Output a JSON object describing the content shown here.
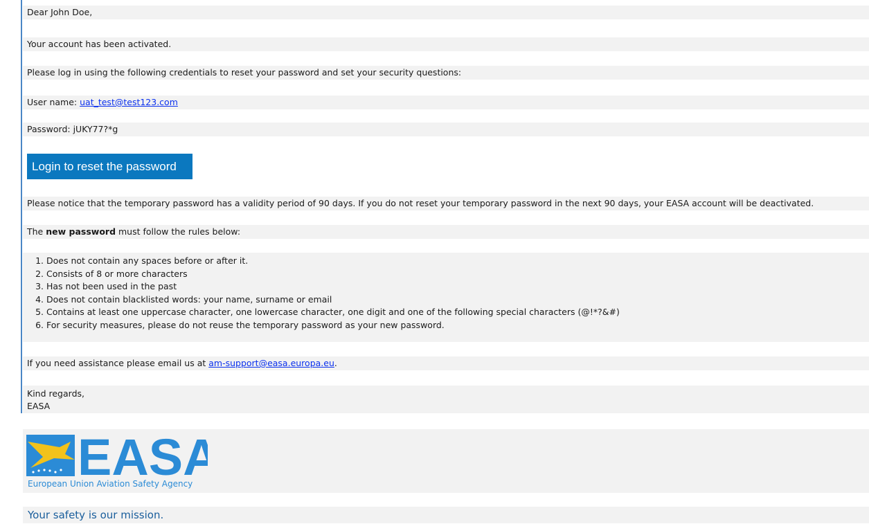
{
  "email": {
    "greeting": "Dear John Doe,",
    "activated": "Your account has been activated.",
    "login_instructions": "Please log in using the following credentials to reset your password and set your security questions:",
    "username_label": "User name: ",
    "username_value": "uat_test@test123.com",
    "password_label": "Password: ",
    "password_value": "jUKY77?*g",
    "login_button": "Login to reset the password",
    "validity_notice": "Please notice that the temporary password has a validity period of 90 days. If you do not reset your temporary password in the next 90 days, your EASA account will be deactivated.",
    "rules_intro_pre": "The ",
    "rules_intro_bold": "new password",
    "rules_intro_post": " must follow the rules below:",
    "rules": [
      "Does not contain any spaces before or after it.",
      "Consists of 8 or more characters",
      "Has not been used in the past",
      "Does not contain blacklisted words: your name, surname or email",
      "Contains at least one uppercase character, one lowercase character, one digit and one of the following special characters (@!*?&#)",
      "For security measures, please do not reuse the temporary password as your new password."
    ],
    "assistance_pre": "If you need assistance please email us at ",
    "assistance_email": "am-support@easa.europa.eu",
    "assistance_post": ".",
    "closing": "Kind regards,",
    "signature": "EASA"
  },
  "logo": {
    "wordmark": "EASA",
    "agency_name": "European Union Aviation Safety Agency",
    "tagline": "Your safety is our mission."
  },
  "colors": {
    "button_bg": "#0b78bf",
    "link": "#0b31ee",
    "brand_dark": "#1a5e9c",
    "brand_light": "#2b8bd6",
    "logo_yellow": "#f2c21b",
    "row_bg": "#f2f2f2"
  }
}
